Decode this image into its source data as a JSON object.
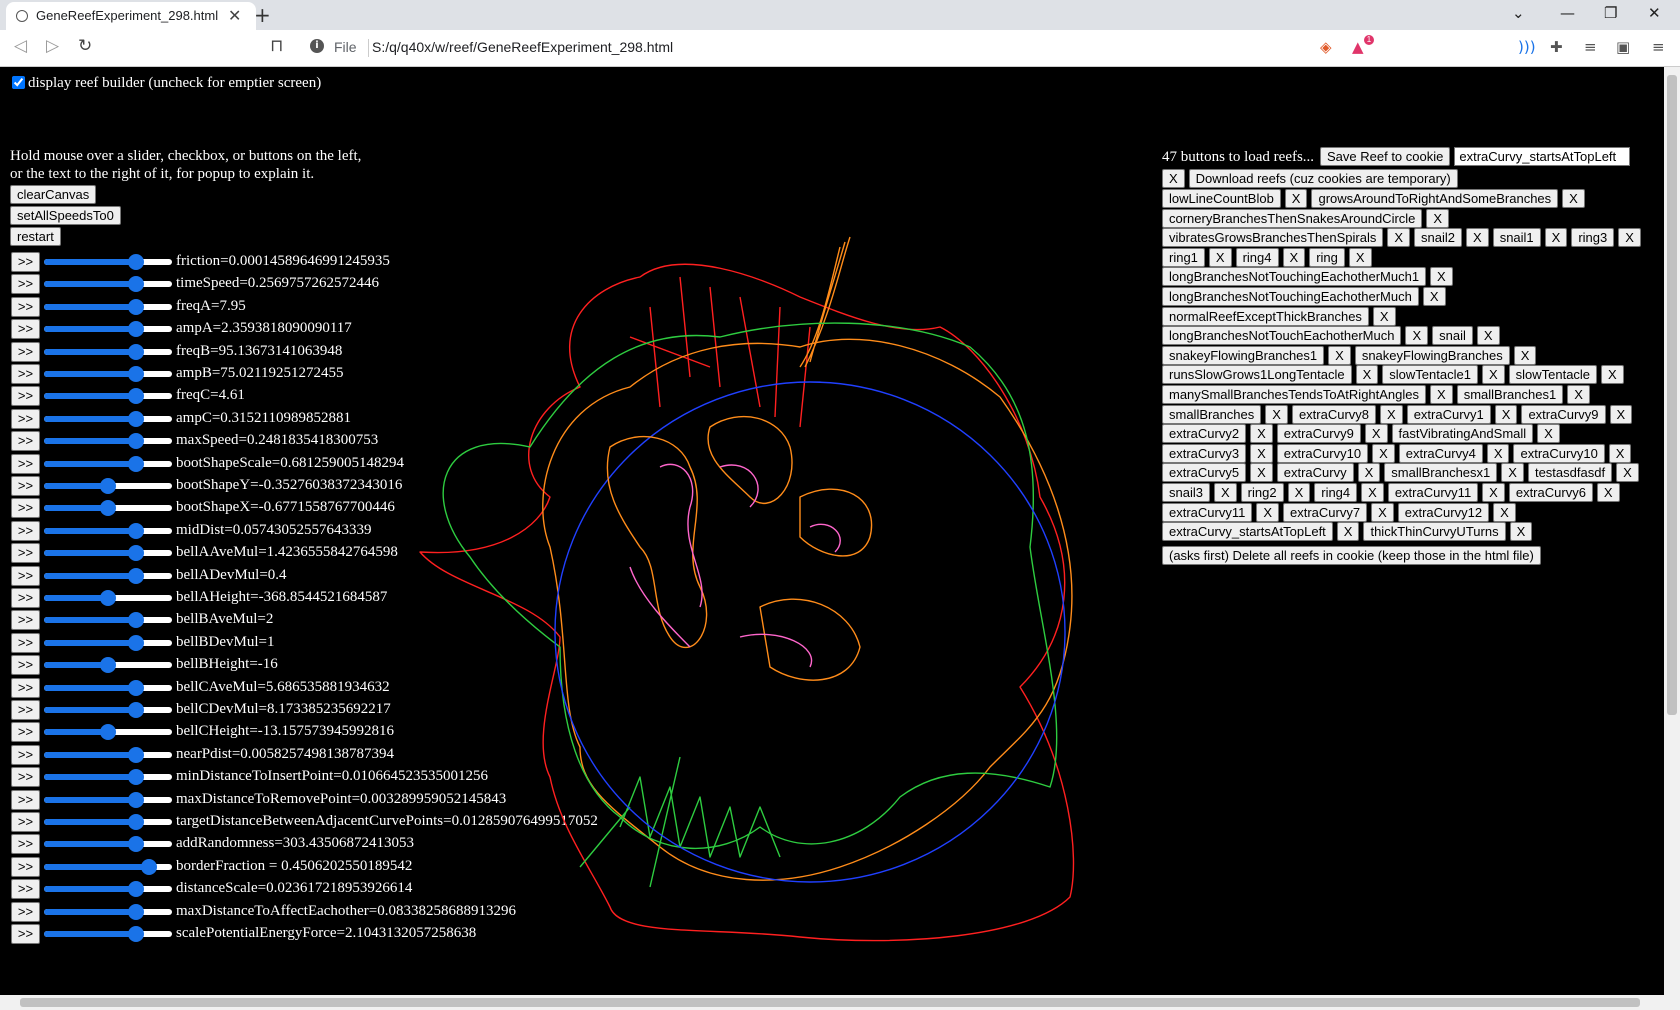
{
  "browser": {
    "tab_title": "GeneReefExperiment_298.html",
    "new_tab": "+",
    "url_scheme": "File",
    "url": "S:/q/q40x/w/reef/GeneReefExperiment_298.html",
    "extension_badge": "1"
  },
  "page": {
    "checkbox_label": "display reef builder (uncheck for emptier screen)",
    "hint_line1": "Hold mouse over a slider, checkbox, or buttons on the left,",
    "hint_line2": "or the text to the right of it, for popup to explain it.",
    "buttons": [
      "clearCanvas",
      "setAllSpeedsTo0",
      "restart"
    ],
    "go_label": ">>",
    "sliders": [
      {
        "label": "friction=0.00014589646991245935",
        "level": 0.72
      },
      {
        "label": "timeSpeed=0.2569757262572446",
        "level": 0.72
      },
      {
        "label": "freqA=7.95",
        "level": 0.72
      },
      {
        "label": "ampA=2.3593818090090117",
        "level": 0.72
      },
      {
        "label": "freqB=95.13673141063948",
        "level": 0.72
      },
      {
        "label": "ampB=75.02119251272455",
        "level": 0.72
      },
      {
        "label": "freqC=4.61",
        "level": 0.72
      },
      {
        "label": "ampC=0.3152110989852881",
        "level": 0.72
      },
      {
        "label": "maxSpeed=0.2481835418300753",
        "level": 0.72
      },
      {
        "label": "bootShapeScale=0.681259005148294",
        "level": 0.72
      },
      {
        "label": "bootShapeY=-0.35276038372343016",
        "level": 0.5
      },
      {
        "label": "bootShapeX=-0.6771558767700446",
        "level": 0.5
      },
      {
        "label": "midDist=0.05743052557643339",
        "level": 0.72
      },
      {
        "label": "bellAAveMul=1.4236555842764598",
        "level": 0.72
      },
      {
        "label": "bellADevMul=0.4",
        "level": 0.72
      },
      {
        "label": "bellAHeight=-368.8544521684587",
        "level": 0.5
      },
      {
        "label": "bellBAveMul=2",
        "level": 0.72
      },
      {
        "label": "bellBDevMul=1",
        "level": 0.72
      },
      {
        "label": "bellBHeight=-16",
        "level": 0.5
      },
      {
        "label": "bellCAveMul=5.686535881934632",
        "level": 0.72
      },
      {
        "label": "bellCDevMul=8.173385235692217",
        "level": 0.72
      },
      {
        "label": "bellCHeight=-13.157573945992816",
        "level": 0.5
      },
      {
        "label": "nearPdist=0.0058257498138787394",
        "level": 0.72
      },
      {
        "label": "minDistanceToInsertPoint=0.010664523535001256",
        "level": 0.72
      },
      {
        "label": "maxDistanceToRemovePoint=0.003289959052145843",
        "level": 0.72
      },
      {
        "label": "targetDistanceBetweenAdjacentCurvePoints=0.012859076499517052",
        "level": 0.72
      },
      {
        "label": "addRandomness=303.43506872413053",
        "level": 0.72
      },
      {
        "label": "borderFraction = 0.4506202550189542",
        "level": 0.82
      },
      {
        "label": "distanceScale=0.023617218953926614",
        "level": 0.72
      },
      {
        "label": "maxDistanceToAffectEachother=0.08338258688913296",
        "level": 0.72
      },
      {
        "label": "scalePotentialEnergyForce=2.1043132057258638",
        "level": 0.72
      }
    ],
    "right": {
      "count_text": "47 buttons to load reefs...",
      "save_label": "Save Reef to cookie",
      "save_name_value": "extraCurvy_startsAtTopLeft",
      "download_label": "Download reefs (cuz cookies are temporary)",
      "x_label": "X",
      "reef_rows": [
        [
          "lowLineCountBlob",
          "growsAroundToRightAndSomeBranches"
        ],
        [
          "corneryBranchesThenSnakesAroundCircle"
        ],
        [
          "vibratesGrowsBranchesThenSpirals",
          "snail2",
          "snail1",
          "ring3"
        ],
        [
          "ring1",
          "ring4",
          "ring"
        ],
        [
          "longBranchesNotTouchingEachotherMuch1"
        ],
        [
          "longBranchesNotTouchingEachotherMuch"
        ],
        [
          "normalReefExceptThickBranches"
        ],
        [
          "longBranchesNotTouchEachotherMuch",
          "snail"
        ],
        [
          "snakeyFlowingBranches1",
          "snakeyFlowingBranches"
        ],
        [
          "runsSlowGrows1LongTentacle",
          "slowTentacle1",
          "slowTentacle"
        ],
        [
          "manySmallBranchesTendsToAtRightAngles",
          "smallBranches1"
        ],
        [
          "smallBranches",
          "extraCurvy8",
          "extraCurvy1",
          "extraCurvy9"
        ],
        [
          "extraCurvy2",
          "extraCurvy9",
          "fastVibratingAndSmall"
        ],
        [
          "extraCurvy3",
          "extraCurvy10",
          "extraCurvy4",
          "extraCurvy10"
        ],
        [
          "extraCurvy5",
          "extraCurvy",
          "smallBranchesx1",
          "testasdfasdf"
        ],
        [
          "snail3",
          "ring2",
          "ring4",
          "extraCurvy11",
          "extraCurvy6"
        ],
        [
          "extraCurvy11",
          "extraCurvy7",
          "extraCurvy12"
        ],
        [
          "extraCurvy_startsAtTopLeft",
          "thickThinCurvyUTurns"
        ]
      ],
      "delete_label": "(asks first) Delete all reefs in cookie (keep those in the html file)"
    }
  },
  "colors": {
    "slider_blue": "#1a73e8",
    "reef_red": "#ff2020",
    "reef_orange": "#ff8c1a",
    "reef_green": "#2ecc40",
    "reef_blue": "#2040ff",
    "reef_pink": "#ff66cc"
  }
}
